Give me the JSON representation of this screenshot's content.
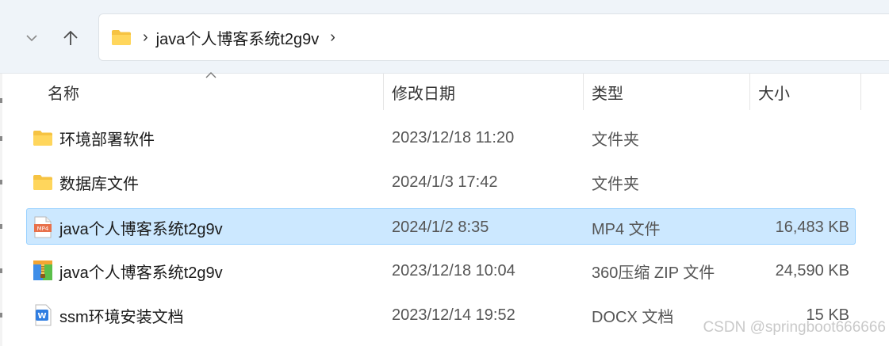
{
  "breadcrumb": {
    "path": "java个人博客系统t2g9v"
  },
  "columns": {
    "name": "名称",
    "date": "修改日期",
    "type": "类型",
    "size": "大小"
  },
  "files": [
    {
      "name": "环境部署软件",
      "date": "2023/12/18 11:20",
      "type": "文件夹",
      "size": "",
      "icon": "folder-icon"
    },
    {
      "name": "数据库文件",
      "date": "2024/1/3 17:42",
      "type": "文件夹",
      "size": "",
      "icon": "folder-icon"
    },
    {
      "name": "java个人博客系统t2g9v",
      "date": "2024/1/2 8:35",
      "type": "MP4 文件",
      "size": "16,483 KB",
      "icon": "mp4-file-icon",
      "selected": true
    },
    {
      "name": "java个人博客系统t2g9v",
      "date": "2023/12/18 10:04",
      "type": "360压缩 ZIP 文件",
      "size": "24,590 KB",
      "icon": "zip-archive-icon"
    },
    {
      "name": "ssm环境安装文档",
      "date": "2023/12/14 19:52",
      "type": "DOCX 文档",
      "size": "15 KB",
      "icon": "docx-file-icon"
    }
  ],
  "watermark": "CSDN @springboot666666",
  "colors": {
    "selection_bg": "#cce8ff",
    "selection_border": "#99d1ff",
    "folder": "#f6c342",
    "nav_bg": "#eff4f9"
  }
}
